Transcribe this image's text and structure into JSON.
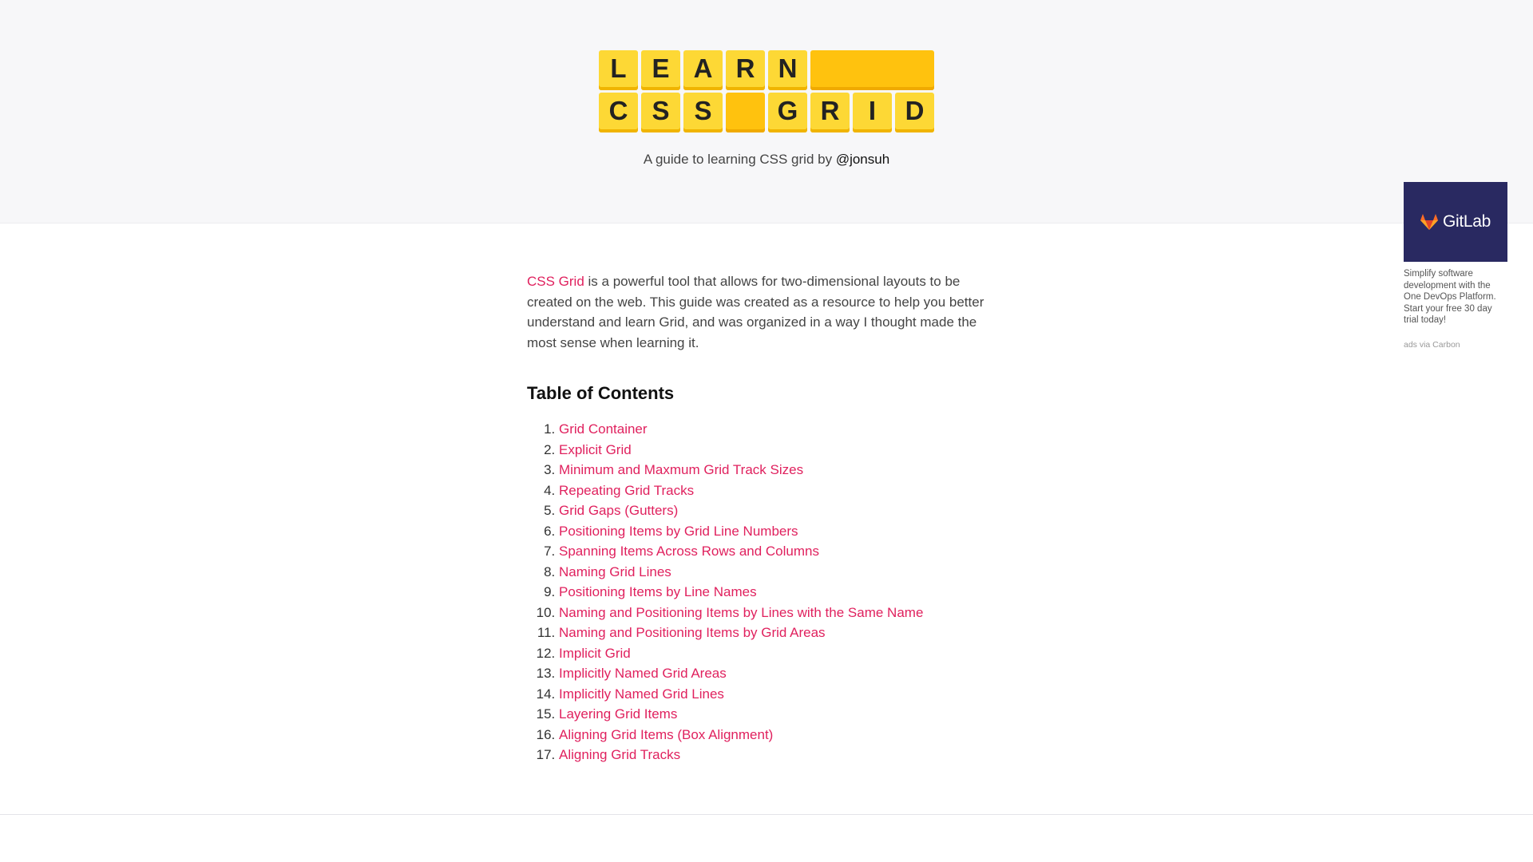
{
  "logo": {
    "row1": [
      "L",
      "E",
      "A",
      "R",
      "N",
      ""
    ],
    "row2": [
      "C",
      "S",
      "S",
      "",
      "G",
      "R",
      "I",
      "D"
    ]
  },
  "tagline": {
    "text": "A guide to learning CSS grid by ",
    "author": "@jonsuh"
  },
  "intro": {
    "link": "CSS Grid",
    "text": " is a powerful tool that allows for two-dimensional layouts to be created on the web. This guide was created as a resource to help you better understand and learn Grid, and was organized in a way I thought made the most sense when learning it."
  },
  "toc": {
    "heading": "Table of Contents",
    "items": [
      "Grid Container",
      "Explicit Grid",
      "Minimum and Maxmum Grid Track Sizes",
      "Repeating Grid Tracks",
      "Grid Gaps (Gutters)",
      "Positioning Items by Grid Line Numbers",
      "Spanning Items Across Rows and Columns",
      "Naming Grid Lines",
      "Positioning Items by Line Names",
      "Naming and Positioning Items by Lines with the Same Name",
      "Naming and Positioning Items by Grid Areas",
      "Implicit Grid",
      "Implicitly Named Grid Areas",
      "Implicitly Named Grid Lines",
      "Layering Grid Items",
      "Aligning Grid Items (Box Alignment)",
      "Aligning Grid Tracks"
    ]
  },
  "ad": {
    "brand": "GitLab",
    "icon": "gitlab-fox-icon",
    "text": "Simplify software development with the One DevOps Platform. Start your free 30 day trial today!",
    "via": "ads via Carbon"
  },
  "colors": {
    "link": "#e0215e",
    "tile": "#fdd835",
    "tile_blank": "#ffc20e",
    "hero_bg": "#f7f7f9",
    "ad_bg": "#292961"
  }
}
